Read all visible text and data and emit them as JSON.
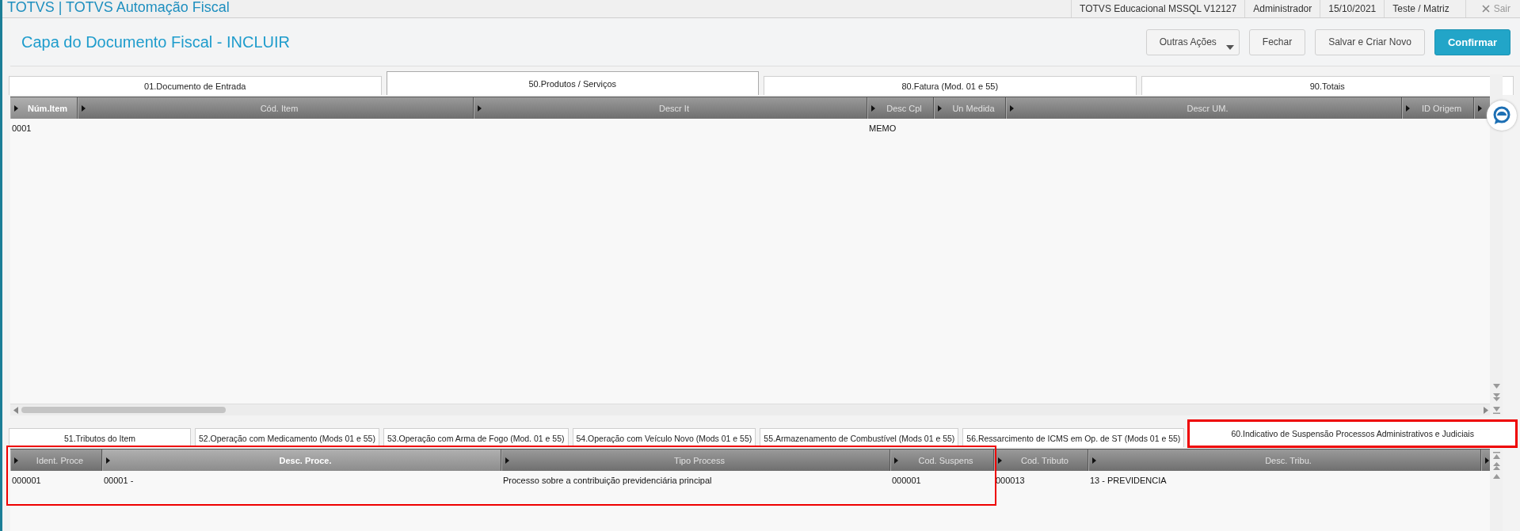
{
  "app_title": "TOTVS | TOTVS Automação Fiscal",
  "session": [
    "TOTVS Educacional MSSQL V12127",
    "Administrador",
    "15/10/2021",
    "Teste / Matriz"
  ],
  "exit_label": "Sair",
  "page_title": "Capa do Documento Fiscal - INCLUIR",
  "actions": [
    {
      "label": "Outras Ações",
      "kind": "menu"
    },
    {
      "label": "Fechar",
      "kind": "default"
    },
    {
      "label": "Salvar e Criar Novo",
      "kind": "default"
    },
    {
      "label": "Confirmar",
      "kind": "primary"
    }
  ],
  "tabs": [
    {
      "label": "01.Documento de Entrada",
      "selected": false
    },
    {
      "label": "50.Produtos / Serviços",
      "selected": true
    },
    {
      "label": "80.Fatura (Mod. 01 e 55)",
      "selected": false
    },
    {
      "label": "90.Totais",
      "selected": false
    }
  ],
  "items_grid": {
    "columns": [
      {
        "label": "Núm.Item",
        "sorted": true
      },
      {
        "label": "Cód. Item",
        "sorted": false
      },
      {
        "label": "Descr It",
        "sorted": false
      },
      {
        "label": "Desc Cpl",
        "sorted": false
      },
      {
        "label": "Un Medida",
        "sorted": false
      },
      {
        "label": "Descr UM.",
        "sorted": false
      },
      {
        "label": "ID Origem",
        "sorted": false
      }
    ],
    "rows": [
      [
        "0001",
        null,
        null,
        "MEMO",
        null,
        null,
        null
      ]
    ]
  },
  "sub_tabs": [
    {
      "label": "51.Tributos do Item",
      "selected": false,
      "highlighted": false
    },
    {
      "label": "52.Operação com Medicamento (Mods 01 e 55)",
      "selected": false,
      "highlighted": false
    },
    {
      "label": "53.Operação com Arma de Fogo (Mod. 01 e 55)",
      "selected": false,
      "highlighted": false
    },
    {
      "label": "54.Operação com Veículo Novo (Mods 01 e 55)",
      "selected": false,
      "highlighted": false
    },
    {
      "label": "55.Armazenamento de Combustível (Mods 01 e 55)",
      "selected": false,
      "highlighted": false
    },
    {
      "label": "56.Ressarcimento de ICMS em Op. de ST (Mods 01 e 55)",
      "selected": false,
      "highlighted": false
    },
    {
      "label": "60.Indicativo de Suspensão Processos Administrativos e Judiciais",
      "selected": true,
      "highlighted": true
    }
  ],
  "process_grid": {
    "columns": [
      {
        "label": "Ident. Proce",
        "sorted": false,
        "highlighted": true
      },
      {
        "label": "Desc. Proce.",
        "sorted": true,
        "highlighted": true
      },
      {
        "label": "Tipo Process",
        "sorted": false,
        "highlighted": true
      },
      {
        "label": "Cod. Suspens",
        "sorted": false,
        "highlighted": true
      },
      {
        "label": "Cod. Tributo",
        "sorted": false,
        "highlighted": false
      },
      {
        "label": "Desc. Tribu.",
        "sorted": false,
        "highlighted": false
      }
    ],
    "rows": [
      [
        "000001",
        "00001 -",
        "Processo sobre a contribuição previdenciária principal",
        "000001",
        "000013",
        "13 - PREVIDENCIA"
      ]
    ]
  }
}
